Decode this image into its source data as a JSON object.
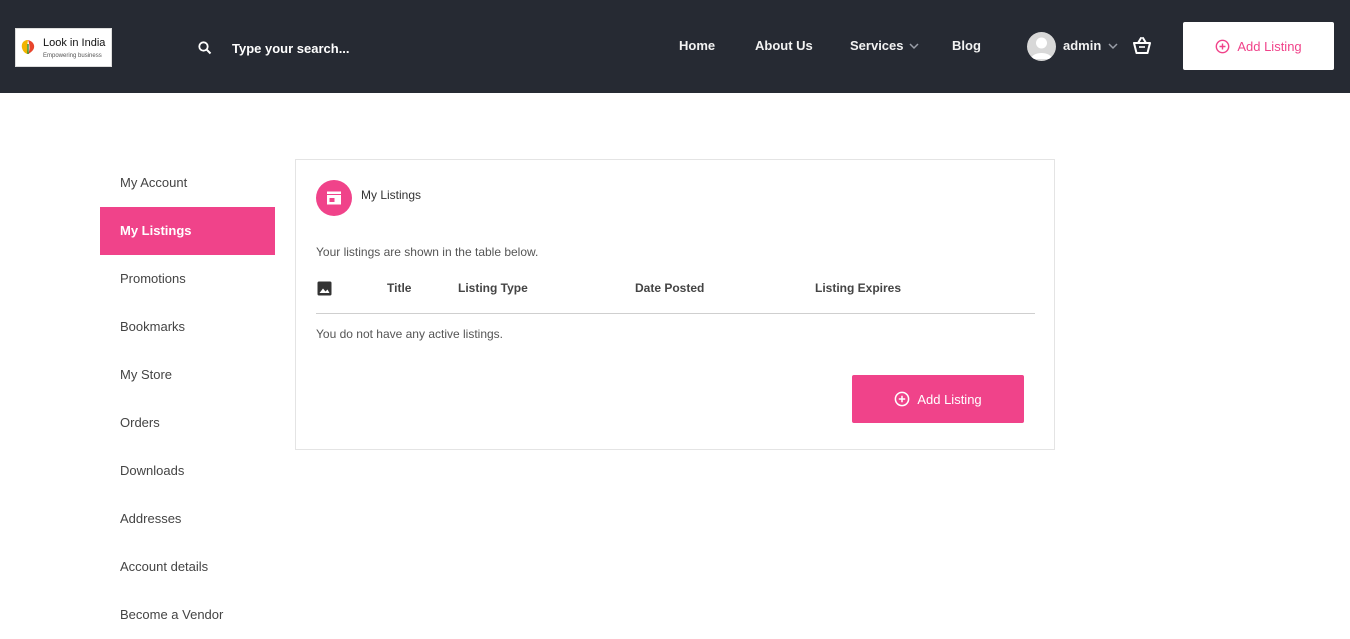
{
  "colors": {
    "header_bg": "#262a33",
    "accent": "#f0438a",
    "card_border": "#e4e4e4"
  },
  "logo": {
    "name": "Look in India",
    "tagline": "Empowering business"
  },
  "search": {
    "placeholder": "Type your search...",
    "icon": "search-icon"
  },
  "nav": {
    "home": "Home",
    "about": "About Us",
    "services": "Services",
    "blog": "Blog"
  },
  "user": {
    "name": "admin",
    "avatar_icon": "user-avatar-icon",
    "cart_icon": "basket-icon"
  },
  "header": {
    "add_listing_label": "Add Listing",
    "add_icon": "plus-circle-icon"
  },
  "sidebar": {
    "items": [
      {
        "label": "My Account",
        "active": false
      },
      {
        "label": "My Listings",
        "active": true
      },
      {
        "label": "Promotions",
        "active": false
      },
      {
        "label": "Bookmarks",
        "active": false
      },
      {
        "label": "My Store",
        "active": false
      },
      {
        "label": "Orders",
        "active": false
      },
      {
        "label": "Downloads",
        "active": false
      },
      {
        "label": "Addresses",
        "active": false
      },
      {
        "label": "Account details",
        "active": false
      },
      {
        "label": "Become a Vendor",
        "active": false
      }
    ]
  },
  "main": {
    "title": "My Listings",
    "title_icon": "store-icon",
    "description": "Your listings are shown in the table below.",
    "table": {
      "image_icon": "image-icon",
      "columns": [
        "Title",
        "Listing Type",
        "Date Posted",
        "Listing Expires"
      ]
    },
    "empty_message": "You do not have any active listings.",
    "add_listing_label": "Add Listing"
  }
}
